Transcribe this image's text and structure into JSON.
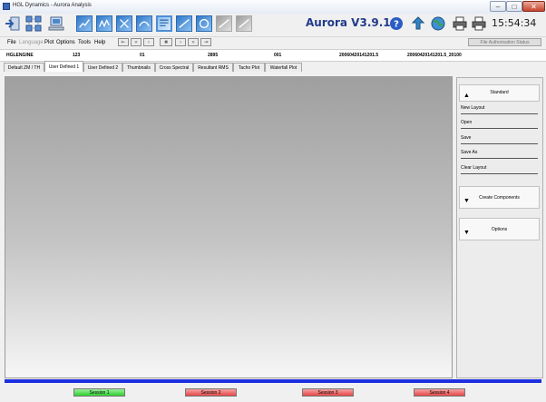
{
  "window": {
    "title": "HGL Dynamics - Aurora Analysis",
    "minimize_glyph": "–",
    "maximize_glyph": "□",
    "close_glyph": "✕"
  },
  "toolbar": {
    "version": "Aurora V3.9.1.1",
    "clock": "15:54:34",
    "icons": [
      "exit-icon",
      "network-icon",
      "computer-icon",
      "plot-icon",
      "plot-icon",
      "plot-icon",
      "plot-icon",
      "plot-icon",
      "plot-icon",
      "plot-icon",
      "plot-icon",
      "plot-icon",
      "help-icon",
      "upload-icon",
      "globe-icon",
      "printer-icon",
      "printer-icon"
    ]
  },
  "menu": {
    "items": [
      {
        "label": "File",
        "enabled": true
      },
      {
        "label": "Language",
        "enabled": false
      },
      {
        "label": "Plot",
        "enabled": true
      },
      {
        "label": "Options",
        "enabled": true
      },
      {
        "label": "Tools",
        "enabled": true
      },
      {
        "label": "Help",
        "enabled": true
      }
    ],
    "nav_glyphs": [
      "⇤",
      "«",
      "‹",
      "■",
      "›",
      "»",
      "⇥"
    ],
    "file_authorisation_status": "File Authorisation Status"
  },
  "info_row": {
    "engine": "HGLENGINE",
    "field_2": "123",
    "field_3": "01",
    "field_4": "2895",
    "field_5": "001",
    "field_6": "20060420141201.5",
    "field_7": "20060420141201.5_20100"
  },
  "tabs": [
    {
      "label": "Default ZM / TH",
      "active": false
    },
    {
      "label": "User Defined 1",
      "active": true
    },
    {
      "label": "User Defined 2",
      "active": false
    },
    {
      "label": "Thumbnails",
      "active": false
    },
    {
      "label": "Cross Spectral",
      "active": false
    },
    {
      "label": "Resultant RMS",
      "active": false
    },
    {
      "label": "Tacho Plot",
      "active": false
    },
    {
      "label": "Waterfall Plot",
      "active": false
    }
  ],
  "side_panel": {
    "standard": {
      "title": "Standard",
      "arrow": "▲",
      "items": [
        "New Layout",
        "Open",
        "Save",
        "Save As",
        "Clear Layout"
      ]
    },
    "create_components": {
      "title": "Create Components",
      "arrow": "▼"
    },
    "options": {
      "title": "Options",
      "arrow": "▼"
    }
  },
  "sessions": [
    {
      "label": "Session 1",
      "active": true
    },
    {
      "label": "Session 2",
      "active": false
    },
    {
      "label": "Session 3",
      "active": false
    },
    {
      "label": "Session 4",
      "active": false
    }
  ]
}
